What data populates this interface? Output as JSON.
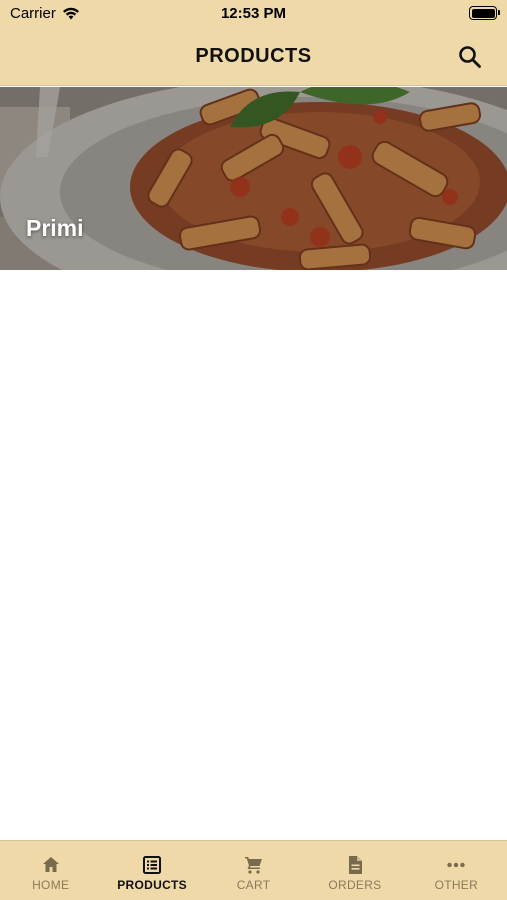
{
  "status_bar": {
    "carrier": "Carrier",
    "time": "12:53 PM"
  },
  "header": {
    "title": "PRODUCTS",
    "search_icon": "search-icon"
  },
  "categories": [
    {
      "label": "Primi"
    }
  ],
  "tab_bar": {
    "items": [
      {
        "label": "HOME",
        "icon": "home-icon",
        "active": false
      },
      {
        "label": "PRODUCTS",
        "icon": "list-icon",
        "active": true
      },
      {
        "label": "CART",
        "icon": "cart-icon",
        "active": false
      },
      {
        "label": "ORDERS",
        "icon": "document-icon",
        "active": false
      },
      {
        "label": "OTHER",
        "icon": "more-icon",
        "active": false
      }
    ]
  },
  "colors": {
    "bar_background": "#efd9a8",
    "tab_inactive": "#8a7a5c",
    "tab_active": "#111111"
  }
}
